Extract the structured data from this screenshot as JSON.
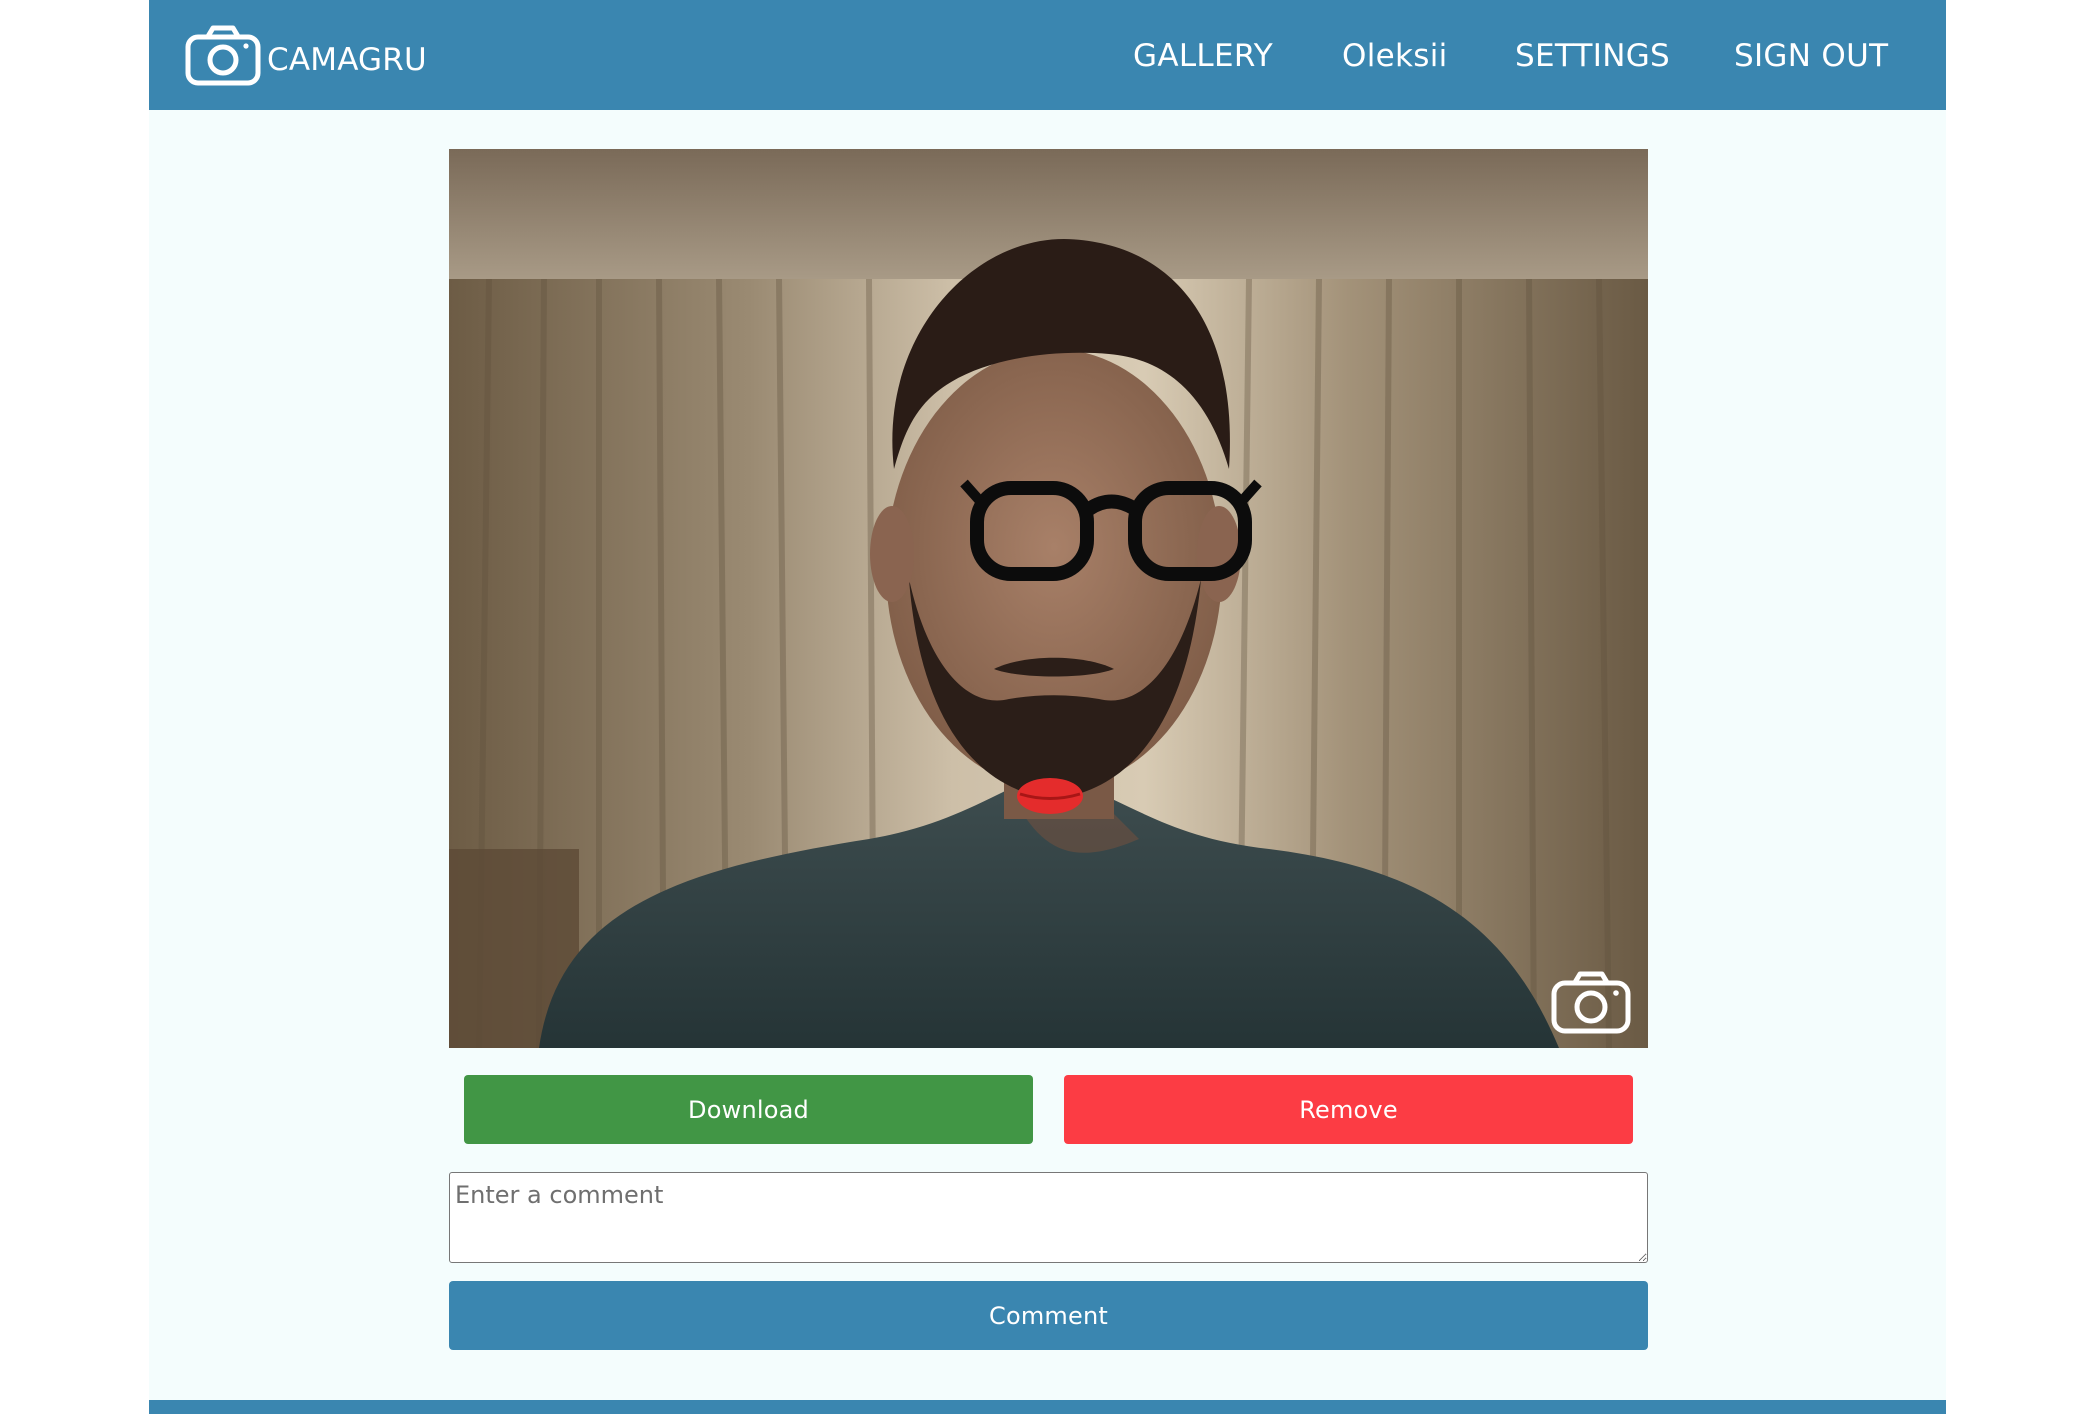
{
  "app": {
    "brand": "CAMAGRU",
    "brand_icon": "camera-icon"
  },
  "nav": {
    "gallery": "GALLERY",
    "user": "Oleksii",
    "settings": "SETTINGS",
    "sign_out": "SIGN OUT"
  },
  "photo": {
    "capture_icon": "camera-icon",
    "stickers": [
      "glasses",
      "lips"
    ]
  },
  "actions": {
    "download_label": "Download",
    "remove_label": "Remove"
  },
  "comment": {
    "placeholder": "Enter a comment",
    "value": "",
    "submit_label": "Comment"
  },
  "colors": {
    "primary": "#3a86b0",
    "download": "#419645",
    "remove": "#fc3c44",
    "background": "#f4fdfd"
  }
}
